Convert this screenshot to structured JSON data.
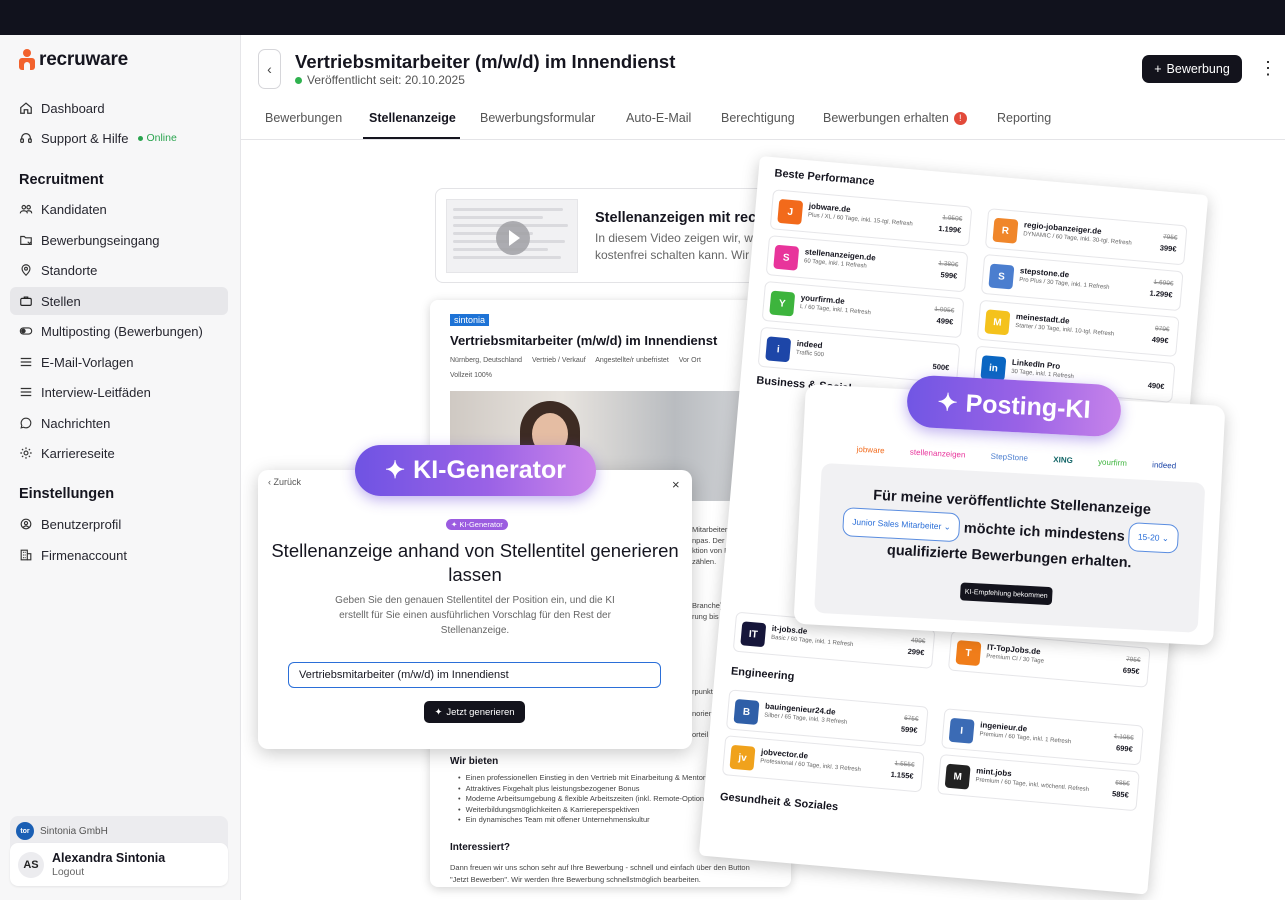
{
  "brand": {
    "name": "recruware"
  },
  "sidebar": {
    "top_items": [
      {
        "label": "Dashboard",
        "icon": "home-icon"
      },
      {
        "label": "Support & Hilfe",
        "icon": "headset-icon",
        "status": "Online"
      }
    ],
    "recruitment_title": "Recruitment",
    "recruitment_items": [
      {
        "label": "Kandidaten",
        "icon": "users-icon"
      },
      {
        "label": "Bewerbungseingang",
        "icon": "inbox-folder-icon"
      },
      {
        "label": "Standorte",
        "icon": "location-pin-icon"
      },
      {
        "label": "Stellen",
        "icon": "briefcase-icon",
        "active": true
      },
      {
        "label": "Multiposting (Bewerbungen)",
        "icon": "toggle-icon"
      },
      {
        "label": "E-Mail-Vorlagen",
        "icon": "list-icon"
      },
      {
        "label": "Interview-Leitfäden",
        "icon": "list-icon"
      },
      {
        "label": "Nachrichten",
        "icon": "chat-icon"
      },
      {
        "label": "Karriereseite",
        "icon": "gear-icon"
      }
    ],
    "settings_title": "Einstellungen",
    "settings_items": [
      {
        "label": "Benutzerprofil",
        "icon": "user-gear-icon"
      },
      {
        "label": "Firmenaccount",
        "icon": "building-icon"
      }
    ],
    "company": {
      "name": "Sintonia GmbH",
      "badge": "tor"
    },
    "user": {
      "initials": "AS",
      "name": "Alexandra Sintonia",
      "action": "Logout"
    }
  },
  "header": {
    "title": "Vertriebsmitarbeiter (m/w/d) im Innendienst",
    "published": "Veröffentlicht seit: 20.10.2025",
    "primary_button": "Bewerbung",
    "more": "⋮"
  },
  "tabs": [
    {
      "label": "Bewerbungen"
    },
    {
      "label": "Stellenanzeige",
      "active": true
    },
    {
      "label": "Bewerbungsformular"
    },
    {
      "label": "Auto-E-Mail"
    },
    {
      "label": "Berechtigung"
    },
    {
      "label": "Bewerbungen erhalten",
      "badge": "!"
    },
    {
      "label": "Reporting"
    }
  ],
  "video_card": {
    "title": "Stellenanzeigen mit recruware er",
    "description": "In diesem Video zeigen wir, wie man in kostenfrei schalten kann. Wir durchlau"
  },
  "job_preview": {
    "company_logo": "sintonia",
    "title": "Vertriebsmitarbeiter (m/w/d) im Innendienst",
    "meta": [
      "Nürnberg, Deutschland",
      "Vertrieb / Verkauf",
      "Angestellte/r unbefristet",
      "Vor Ort",
      "Vollzeit 100%"
    ],
    "text_fragments": [
      "Mitarbeitern weltweit",
      "npas. Der",
      "ktion von Rohren,",
      "zählen.",
      "Branche)",
      "rung bis Abschluss",
      "rpunkt Wirtschaft",
      "norientierung",
      "orteil"
    ],
    "benefits_title": "Wir bieten",
    "benefits": [
      "Einen professionellen Einstieg in den Vertrieb mit Einarbeitung & Mentoring",
      "Attraktives Fixgehalt plus leistungsbezogener Bonus",
      "Moderne Arbeitsumgebung & flexible Arbeitszeiten (inkl. Remote-Option)",
      "Weiterbildungsmöglichkeiten & Karriereperspektiven",
      "Ein dynamisches Team mit offener Unternehmenskultur"
    ],
    "interest_title": "Interessiert?",
    "interest_text": "Dann freuen wir uns schon sehr auf Ihre Bewerbung - schnell und einfach über den Button \"Jetzt Bewerben\". Wir werden Ihre Bewerbung schnellstmöglich bearbeiten."
  },
  "ki_generator": {
    "pill_label": "KI-Generator",
    "back": "Zurück",
    "close": "×",
    "chip": "KI-Generator",
    "heading": "Stellenanzeige anhand von Stellentitel generieren lassen",
    "description": "Geben Sie den genauen Stellentitel der Position ein, und die KI erstellt für Sie einen ausführlichen Vorschlag für den Rest der Stellenanzeige.",
    "input_value": "Vertriebsmitarbeiter (m/w/d) im Innendienst",
    "button": "Jetzt generieren"
  },
  "multiposting": {
    "best_title": "Beste Performance",
    "best_left": [
      {
        "name": "jobware.de",
        "sub": "Plus / XL / 60 Tage, inkl. 15-tgl. Refresh",
        "old": "1.950€",
        "price": "1.199€",
        "color": "#f26a1b",
        "icon": "jobware-logo-icon"
      },
      {
        "name": "stellenanzeigen.de",
        "sub": "60 Tage, inkl. 1 Refresh",
        "old": "1.380€",
        "price": "599€",
        "color": "#e8349b",
        "icon": "stellenanzeigen-logo-icon"
      },
      {
        "name": "yourfirm.de",
        "sub": "L / 60 Tage, inkl. 1 Refresh",
        "old": "1.095€",
        "price": "499€",
        "color": "#3db43d",
        "icon": "yourfirm-logo-icon"
      },
      {
        "name": "indeed",
        "sub": "Traffic 500",
        "old": "",
        "price": "500€",
        "color": "#1d46a8",
        "icon": "indeed-logo-icon"
      }
    ],
    "best_right": [
      {
        "name": "regio-jobanzeiger.de",
        "sub": "DYNAMIC / 60 Tage, inkl. 30-tgl. Refresh",
        "old": "795€",
        "price": "399€",
        "color": "#f0862a",
        "icon": "regio-logo-icon"
      },
      {
        "name": "stepstone.de",
        "sub": "Pro Plus / 30 Tage, inkl. 1 Refresh",
        "old": "1.699€",
        "price": "1.299€",
        "color": "#4b7ecf",
        "icon": "stepstone-logo-icon"
      },
      {
        "name": "meinestadt.de",
        "sub": "Starter / 30 Tage, inkl. 10-tgl. Refresh",
        "old": "979€",
        "price": "499€",
        "color": "#f4c21c",
        "icon": "meinestadt-logo-icon"
      },
      {
        "name": "LinkedIn Pro",
        "sub": "30 Tage, inkl. 1 Refresh",
        "old": "",
        "price": "490€",
        "color": "#0a66c2",
        "icon": "linkedin-logo-icon"
      }
    ],
    "business_title": "Business & Social",
    "posting_pill": "Posting-KI",
    "logo_strip": [
      "jobware",
      "stellenanzeigen",
      "StepStone",
      "XING",
      "yourfirm",
      "indeed"
    ],
    "posting_prefix": "Für meine veröffentlichte Stellenanzeige",
    "posting_select_role": "Junior Sales Mitarbeiter",
    "posting_middle": "möchte ich mindestens",
    "posting_select_count": "15-20",
    "posting_suffix": "qualifizierte Bewerbungen erhalten.",
    "posting_button": "KI-Empfehlung bekommen",
    "it_items": [
      {
        "name": "it-jobs.de",
        "sub": "Basic / 60 Tage, inkl. 1 Refresh",
        "old": "499€",
        "price": "299€",
        "color": "#16163a",
        "icon": "itjobs-logo-icon"
      },
      {
        "name": "IT-TopJobs.de",
        "sub": "Premium CI / 30 Tage",
        "old": "795€",
        "price": "695€",
        "color": "#f07d1a",
        "icon": "ittopjobs-logo-icon"
      }
    ],
    "engineering_title": "Engineering",
    "engineering_items": [
      {
        "name": "bauingenieur24.de",
        "sub": "Silber / 65 Tage, inkl. 3 Refresh",
        "old": "675€",
        "price": "599€",
        "color": "#2f5fa8",
        "icon": "bauingenieur-logo-icon"
      },
      {
        "name": "ingenieur.de",
        "sub": "Premium / 60 Tage, inkl. 1 Refresh",
        "old": "1.195€",
        "price": "699€",
        "color": "#3b6bb5",
        "icon": "ingenieur-logo-icon"
      },
      {
        "name": "jobvector.de",
        "sub": "Professional / 60 Tage, inkl. 3 Refresh",
        "old": "1.555€",
        "price": "1.155€",
        "color": "#f0a21c",
        "icon": "jobvector-logo-icon"
      },
      {
        "name": "mint.jobs",
        "sub": "Premium / 60 Tage, inkl. wöchentl. Refresh",
        "old": "685€",
        "price": "585€",
        "color": "#222222",
        "icon": "mintjobs-logo-icon"
      }
    ],
    "health_title": "Gesundheit & Soziales"
  }
}
